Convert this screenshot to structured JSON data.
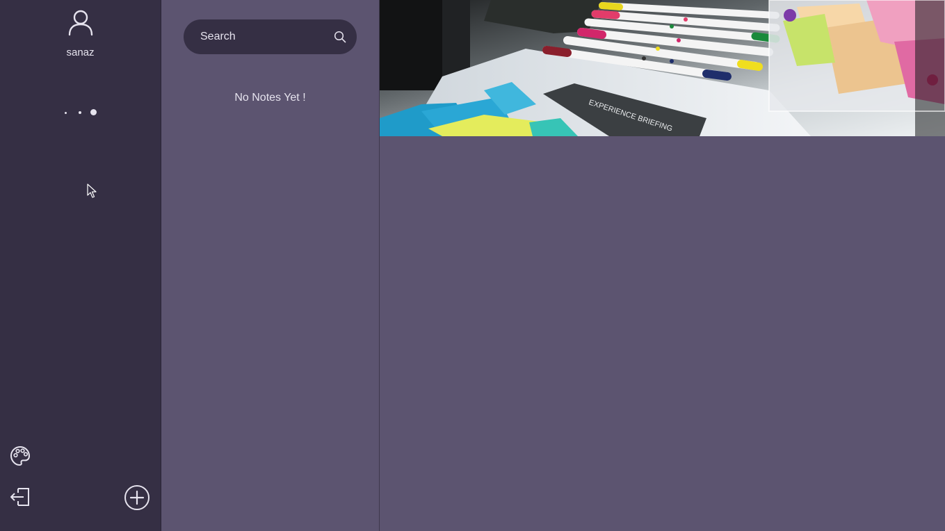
{
  "sidebar": {
    "user": {
      "icon": "user-icon",
      "name": "sanaz"
    },
    "loading_indicator": "dots-icon",
    "bottom_actions": {
      "palette": "palette-icon",
      "logout": "logout-icon",
      "add_note": "plus-circle-icon"
    }
  },
  "notes_list": {
    "search": {
      "placeholder": "Search",
      "value": "",
      "icon": "search-icon"
    },
    "empty_message": "No Notes Yet !"
  },
  "main": {
    "banner": {
      "description_icon": "desk-photo",
      "document_title": "EXPERIENCE BRIEFING"
    }
  },
  "colors": {
    "sidebar_bg": "#352f44",
    "panel_bg": "#5c5470",
    "text": "#e6e3ee"
  }
}
